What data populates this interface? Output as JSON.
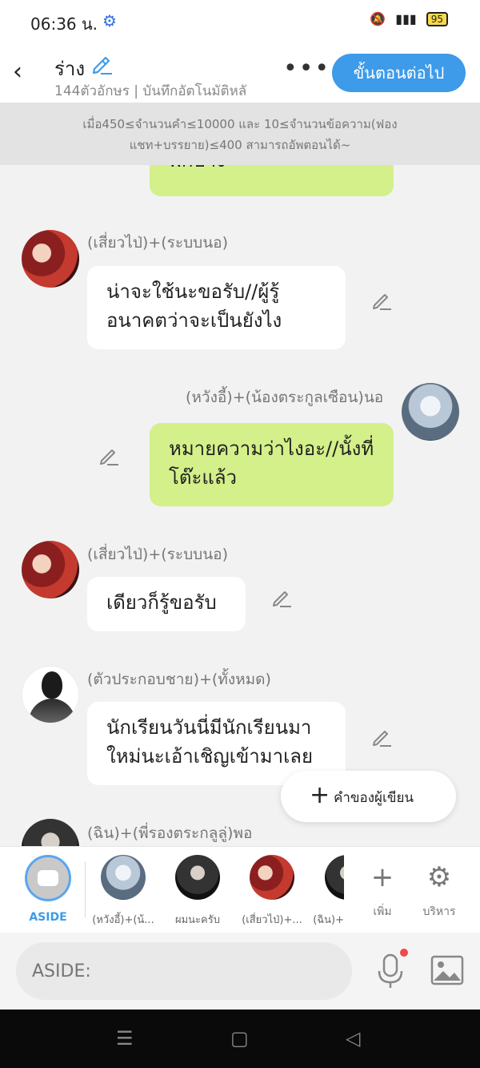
{
  "status": {
    "time": "06:36 น.",
    "battery": "95"
  },
  "header": {
    "title": "ร่าง",
    "subtitle": "144ตัวอักษร | บันทึกอัตโนมัติหลั",
    "more": "•••",
    "next_button": "ขั้นตอนต่อไป"
  },
  "notice": "เมื่อ450≤จำนวนคำ≤10000 และ 10≤จำนวนข้อความ(ฟองแชท+บรรยาย)≤400 สามารถอัพตอนได้~",
  "messages": [
    {
      "text": "พักบ้าง"
    },
    {
      "sender": "(เสี่ยวไป่)+(ระบบนอ)",
      "text": "น่าจะใช้นะขอรับ//ผู้รู้อนาคตว่าจะเป็นยังไง"
    },
    {
      "sender": "(หวังอี้)+(น้องตระกูลเซือน)นอ",
      "text": "หมายความว่าไงอะ//นั้งที่โต๊ะแล้ว"
    },
    {
      "sender": "(เสี่ยวไป่)+(ระบบนอ)",
      "text": "เดียวก็รู้ขอรับ"
    },
    {
      "sender": "(ตัวประกอบชาย)+(ทั้งหมด)",
      "text": "นักเรียนวันนี่มีนักเรียนมาใหม่นะเอ้าเชิญเข้ามาเลย"
    },
    {
      "sender": "(ฉิน)+(พี่รองตระกลูลู่)พอ"
    }
  ],
  "author_button": "คำของผู้เขียน",
  "characters": [
    {
      "label": "ASIDE"
    },
    {
      "label": "(หวังอี้)+(น้..."
    },
    {
      "label": "ผมนะครับ"
    },
    {
      "label": "(เสี่ยวไป่)+..."
    },
    {
      "label": "(ฉิน)+"
    }
  ],
  "tools": {
    "add": "เพิ่ม",
    "manage": "บริหาร"
  },
  "input": {
    "placeholder": "ASIDE:"
  },
  "icons": {
    "back": "chevron-left",
    "edit": "pencil",
    "more": "ellipsis",
    "add": "plus",
    "manage": "gear",
    "mic": "microphone",
    "image": "picture"
  },
  "colors": {
    "accent": "#3d9be9",
    "bubble_green": "#d4f08a",
    "bubble_white": "#ffffff"
  }
}
